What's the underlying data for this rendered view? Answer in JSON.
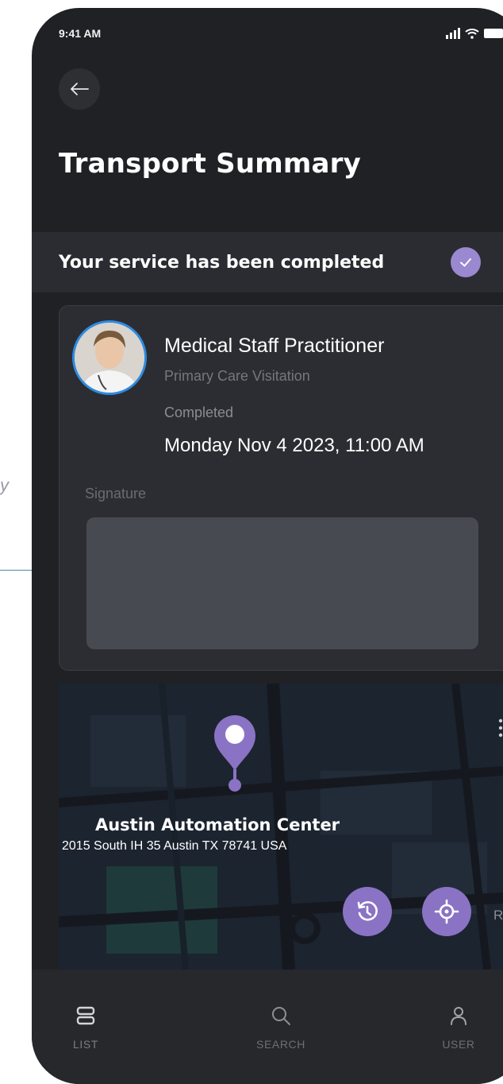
{
  "annotation": {
    "fragment_text": "y"
  },
  "status_bar": {
    "time": "9:41 AM"
  },
  "header": {
    "title": "Transport Summary"
  },
  "banner": {
    "text": "Your service has been completed"
  },
  "staff_card": {
    "name": "Medical Staff Practitioner",
    "role": "Primary Care Visitation",
    "status_label": "Completed",
    "date": "Monday Nov 4 2023, 11:00 AM",
    "signature_label": "Signature"
  },
  "map": {
    "place_name": "Austin Automation Center",
    "address": "2015 South IH 35 Austin TX 78741 USA",
    "edge_label": "Ra",
    "accent_color": "#8a73c4"
  },
  "bottom_nav": {
    "items": [
      {
        "label": "LIST",
        "icon": "list-icon"
      },
      {
        "label": "SEARCH",
        "icon": "search-icon"
      },
      {
        "label": "USER",
        "icon": "user-icon"
      }
    ]
  }
}
